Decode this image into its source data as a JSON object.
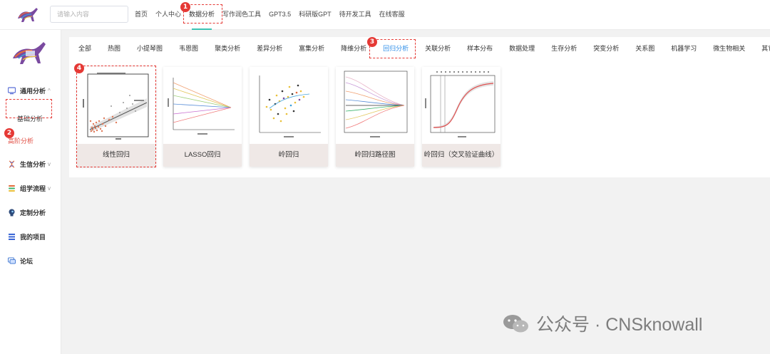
{
  "header": {
    "search_placeholder": "请输入内容",
    "nav": [
      "首页",
      "个人中心",
      "数据分析",
      "写作润色工具",
      "GPT3.5",
      "科研版GPT",
      "待开发工具",
      "在线客服"
    ],
    "active_nav": "数据分析"
  },
  "sidebar": {
    "general": {
      "label": "通用分析",
      "chevron": "^"
    },
    "general_subitems": [
      "基础分析",
      "高阶分析"
    ],
    "active_subitem": "高阶分析",
    "items": [
      {
        "label": "生信分析",
        "icon": "dna-icon",
        "chevron": "v"
      },
      {
        "label": "组学流程",
        "icon": "layers-icon",
        "chevron": "v"
      },
      {
        "label": "定制分析",
        "icon": "head-icon",
        "chevron": ""
      },
      {
        "label": "我的项目",
        "icon": "list-icon",
        "chevron": ""
      },
      {
        "label": "论坛",
        "icon": "chat-icon",
        "chevron": ""
      }
    ]
  },
  "tabs": [
    "全部",
    "热图",
    "小提琴图",
    "韦恩图",
    "聚类分析",
    "差异分析",
    "富集分析",
    "降维分析",
    "回归分析",
    "关联分析",
    "样本分布",
    "数据处理",
    "生存分析",
    "突变分析",
    "关系图",
    "机器学习",
    "微生物相关",
    "其它"
  ],
  "active_tab": "回归分析",
  "cards": [
    {
      "label": "线性回归",
      "thumb": "scatter-regression"
    },
    {
      "label": "LASSO回归",
      "thumb": "lasso-lines"
    },
    {
      "label": "岭回归",
      "thumb": "ridge-scatter"
    },
    {
      "label": "岭回归路径图",
      "thumb": "ridge-path"
    },
    {
      "label": "岭回归（交叉验证曲线）",
      "thumb": "cv-curve"
    }
  ],
  "badges": [
    "1",
    "2",
    "3",
    "4"
  ],
  "watermark": {
    "text": "公众号 · CNSknowall"
  },
  "colors": {
    "accent": "#3cc4b4",
    "active_tab": "#2f8ee8",
    "highlight": "#e53935",
    "active_sub": "#e04a3f"
  }
}
